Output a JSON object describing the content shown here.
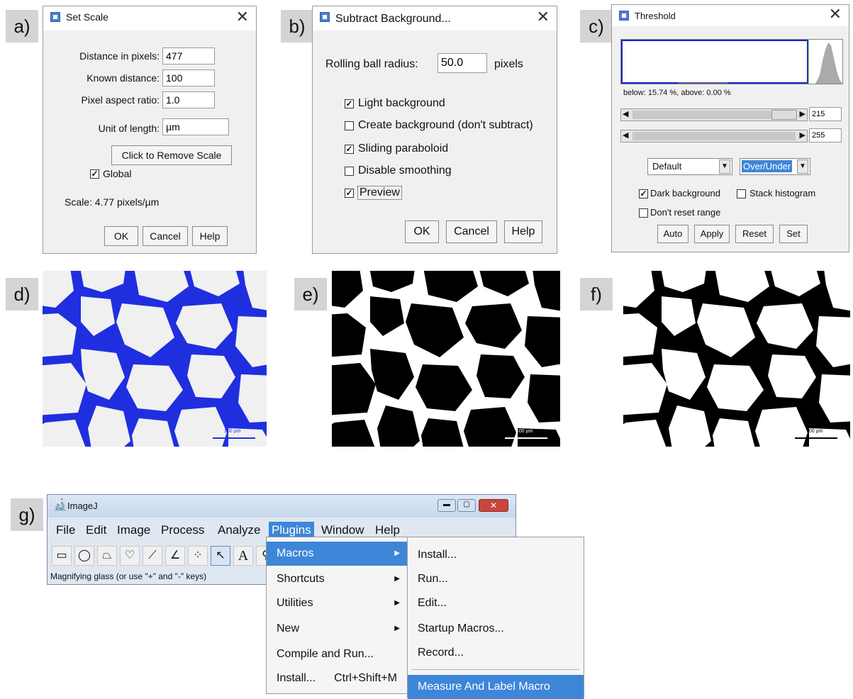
{
  "panel_labels": [
    "a)",
    "b)",
    "c)",
    "d)",
    "e)",
    "f)",
    "g)"
  ],
  "set_scale": {
    "title": "Set Scale",
    "distance_pixels_label": "Distance in pixels:",
    "distance_pixels_value": "477",
    "known_distance_label": "Known distance:",
    "known_distance_value": "100",
    "aspect_ratio_label": "Pixel aspect ratio:",
    "aspect_ratio_value": "1.0",
    "unit_label": "Unit of length:",
    "unit_value": "µm",
    "remove_scale_label": "Click to Remove Scale",
    "global_label": "Global",
    "global_checked": true,
    "scale_text": "Scale: 4.77 pixels/µm",
    "ok_label": "OK",
    "cancel_label": "Cancel",
    "help_label": "Help"
  },
  "subtract_background": {
    "title": "Subtract Background...",
    "radius_label": "Rolling ball radius:",
    "radius_value": "50.0",
    "radius_unit": "pixels",
    "light_bg_label": "Light background",
    "light_bg_checked": true,
    "create_bg_label": "Create background (don't subtract)",
    "create_bg_checked": false,
    "sliding_label": "Sliding paraboloid",
    "sliding_checked": true,
    "disable_smoothing_label": "Disable smoothing",
    "disable_smoothing_checked": false,
    "preview_label": "Preview",
    "preview_checked": true,
    "ok_label": "OK",
    "cancel_label": "Cancel",
    "help_label": "Help"
  },
  "threshold": {
    "title": "Threshold",
    "stats_text": "below: 15.74 %,  above: 0.00 %",
    "slider1_value": "215",
    "slider2_value": "255",
    "method_value": "Default",
    "mode_value": "Over/Under",
    "dark_bg_label": "Dark background",
    "dark_bg_checked": true,
    "stack_hist_label": "Stack histogram",
    "stack_hist_checked": false,
    "dont_reset_label": "Don't reset range",
    "dont_reset_checked": false,
    "auto_label": "Auto",
    "apply_label": "Apply",
    "reset_label": "Reset",
    "set_label": "Set"
  },
  "micrographs": {
    "scale_bar_label": "100 µm",
    "d_membrane_color": "#1f2fe0",
    "d_cell_color": "#f0f0f0"
  },
  "imagej": {
    "title": "ImageJ",
    "menubar": [
      "File",
      "Edit",
      "Image",
      "Process",
      "Analyze",
      "Plugins",
      "Window",
      "Help"
    ],
    "active_menu": "Plugins",
    "status_text": "Magnifying glass (or use \"+\" and \"-\" keys)",
    "plugins_menu": [
      "Macros",
      "Shortcuts",
      "Utilities",
      "New",
      "Compile and Run...",
      "Install..."
    ],
    "install_shortcut": "Ctrl+Shift+M",
    "macros_submenu": [
      "Install...",
      "Run...",
      "Edit...",
      "Startup Macros...",
      "Record...",
      "Measure And Label Macro"
    ],
    "highlight_color": "#3d86d8"
  }
}
